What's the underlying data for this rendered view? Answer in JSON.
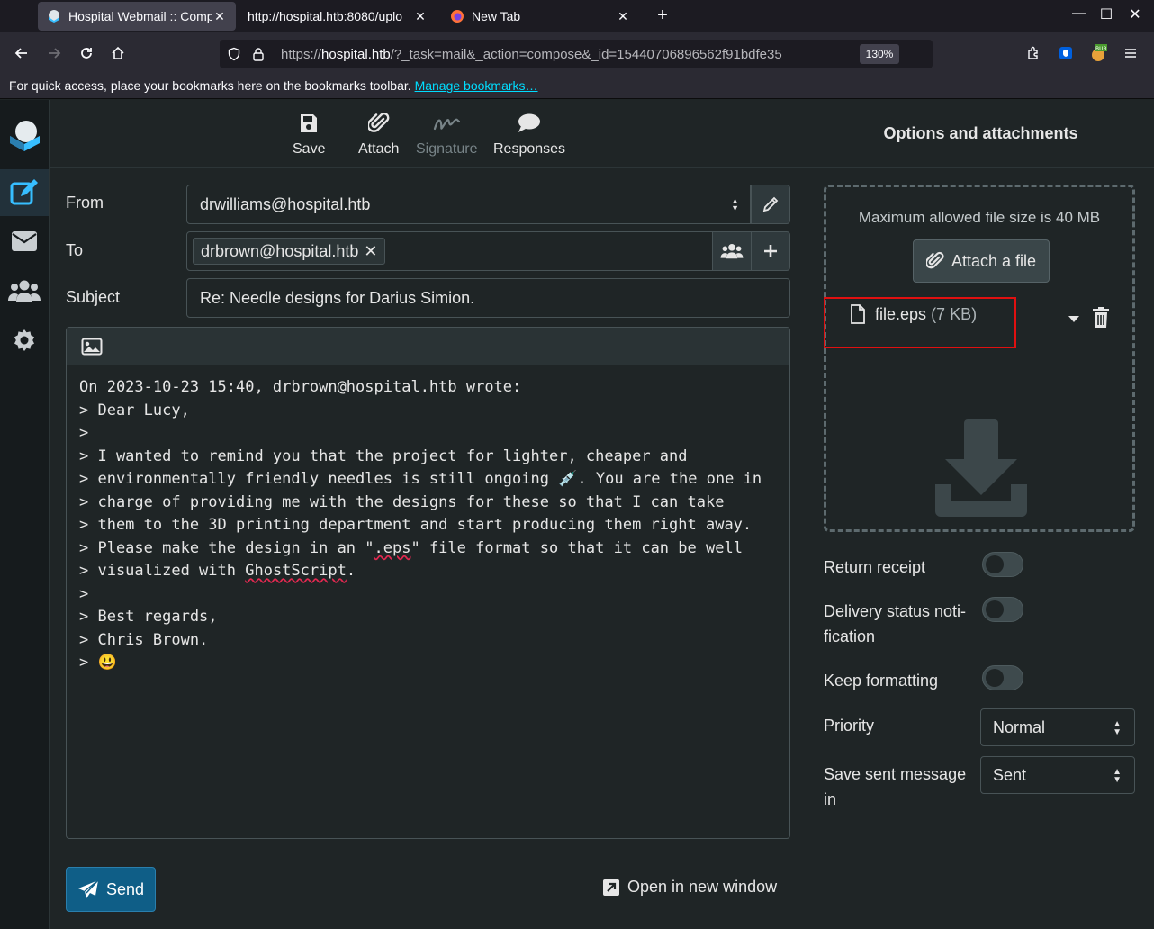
{
  "browser": {
    "tabs": [
      {
        "title": "Hospital Webmail :: Comp",
        "active": true
      },
      {
        "title": "http://hospital.htb:8080/uplo",
        "active": false
      },
      {
        "title": "New Tab",
        "active": false
      }
    ],
    "url_prefix": "https://",
    "url_host": "hospital.htb",
    "url_rest": "/?_task=mail&_action=compose&_id=15440706896562f91bdfe35",
    "zoom": "130%",
    "bookmarks_text": "For quick access, place your bookmarks here on the bookmarks toolbar.",
    "bookmarks_link": "Manage bookmarks…",
    "ext_badge": "BUR"
  },
  "toolbar": {
    "save": "Save",
    "attach": "Attach",
    "signature": "Signature",
    "responses": "Responses"
  },
  "form": {
    "from_label": "From",
    "from_value": "drwilliams@hospital.htb",
    "to_label": "To",
    "to_recipient": "drbrown@hospital.htb",
    "subject_label": "Subject",
    "subject_value": "Re: Needle designs for Darius Simion."
  },
  "message": {
    "lines": [
      "On 2023-10-23 15:40, drbrown@hospital.htb wrote:",
      "> Dear Lucy,",
      ">",
      "> I wanted to remind you that the project for lighter, cheaper and",
      "> environmentally friendly needles is still ongoing 💉. You are the one in",
      "> charge of providing me with the designs for these so that I can take",
      "> them to the 3D printing department and start producing them right away.",
      "> Please make the design in an \".eps\" file format so that it can be well",
      "> visualized with GhostScript.",
      ">",
      "> Best regards,",
      "> Chris Brown.",
      "> 😃"
    ]
  },
  "actions": {
    "send": "Send",
    "open_new_window": "Open in new window"
  },
  "side": {
    "title": "Options and attachments",
    "max_size": "Maximum allowed file size is 40 MB",
    "attach_file": "Attach a file",
    "file_name": "file.eps",
    "file_size": "(7 KB)",
    "return_receipt": "Return receipt",
    "delivery_status_1": "Delivery status noti-",
    "delivery_status_2": "fication",
    "keep_formatting": "Keep formatting",
    "priority_label": "Priority",
    "priority_value": "Normal",
    "save_sent_1": "Save sent message",
    "save_sent_2": "in",
    "save_sent_value": "Sent"
  },
  "colors": {
    "accent": "#37beff",
    "send_button": "#0f5e87",
    "highlight_box": "#e01010"
  }
}
